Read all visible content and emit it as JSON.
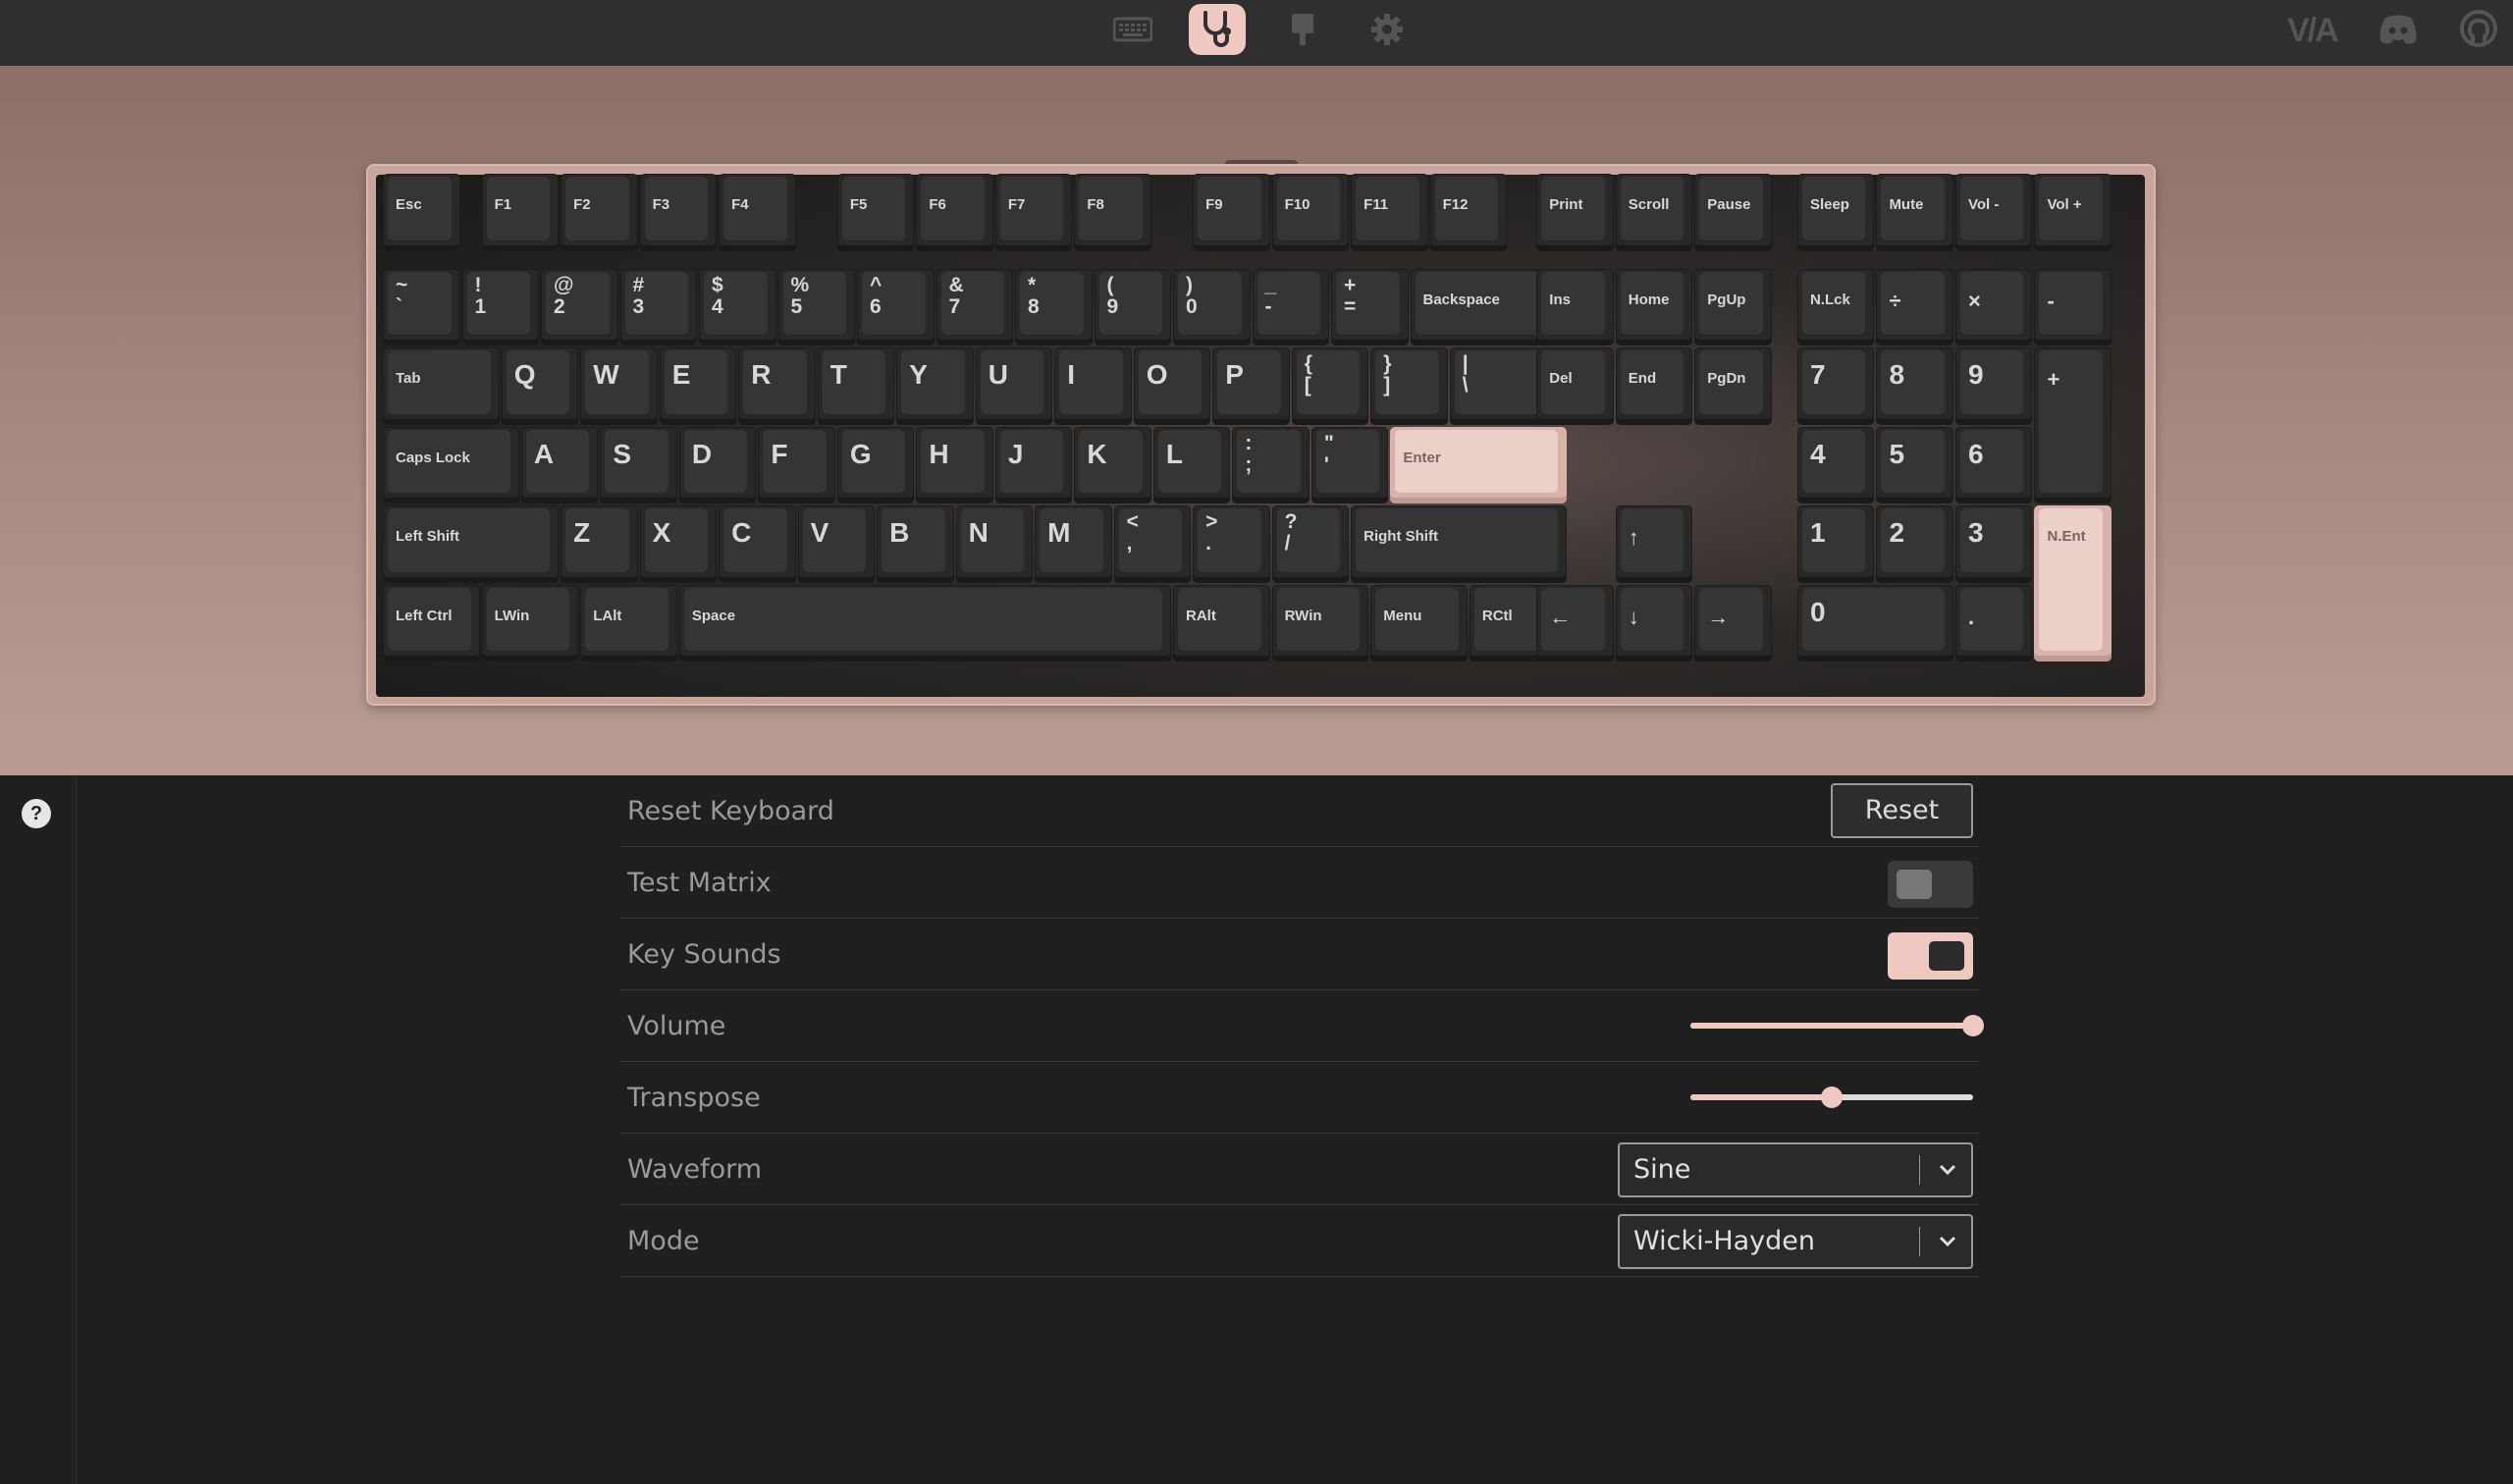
{
  "nav": {
    "items": [
      {
        "name": "keyboard-icon",
        "active": false
      },
      {
        "name": "stethoscope-icon",
        "active": true
      },
      {
        "name": "design-icon",
        "active": false
      },
      {
        "name": "gear-icon",
        "active": false
      }
    ],
    "brand_text": "V/A",
    "accent_color": "#efc8c1"
  },
  "keyboard": {
    "rows": {
      "function": [
        "Esc",
        "F1",
        "F2",
        "F3",
        "F4",
        "F5",
        "F6",
        "F7",
        "F8",
        "F9",
        "F10",
        "F11",
        "F12",
        "Print",
        "Scroll",
        "Pause",
        "Sleep",
        "Mute",
        "Vol -",
        "Vol +"
      ],
      "number": [
        "~\n`",
        "!\n1",
        "@\n2",
        "#\n3",
        "$\n4",
        "%\n5",
        "^\n6",
        "&\n7",
        "*\n8",
        "(\n9",
        ")\n0",
        "_\n-",
        "+\n=",
        "Backspace",
        "Ins",
        "Home",
        "PgUp",
        "N.Lck",
        "÷",
        "×",
        "-"
      ],
      "qwerty": [
        "Tab",
        "Q",
        "W",
        "E",
        "R",
        "T",
        "Y",
        "U",
        "I",
        "O",
        "P",
        "{\n[",
        "}\n]",
        "|\n\\",
        "Del",
        "End",
        "PgDn",
        "7",
        "8",
        "9",
        "+"
      ],
      "home": [
        "Caps Lock",
        "A",
        "S",
        "D",
        "F",
        "G",
        "H",
        "J",
        "K",
        "L",
        ":\n;",
        "\"\n'",
        "Enter",
        "4",
        "5",
        "6"
      ],
      "shift": [
        "Left Shift",
        "Z",
        "X",
        "C",
        "V",
        "B",
        "N",
        "M",
        "<\n,",
        ">\n.",
        "?\n/",
        "Right Shift",
        "↑",
        "1",
        "2",
        "3",
        "N.Ent"
      ],
      "bottom": [
        "Left Ctrl",
        "LWin",
        "LAlt",
        "Space",
        "RAlt",
        "RWin",
        "Menu",
        "RCtl",
        "←",
        "↓",
        "→",
        "0",
        "."
      ]
    }
  },
  "settings": {
    "reset_keyboard": {
      "label": "Reset Keyboard",
      "button": "Reset"
    },
    "test_matrix": {
      "label": "Test Matrix",
      "enabled": false
    },
    "key_sounds": {
      "label": "Key Sounds",
      "enabled": true
    },
    "volume": {
      "label": "Volume",
      "value": 1.0
    },
    "transpose": {
      "label": "Transpose",
      "value": 0.5
    },
    "waveform": {
      "label": "Waveform",
      "value": "Sine"
    },
    "mode": {
      "label": "Mode",
      "value": "Wicki-Hayden"
    }
  },
  "help_icon": "?"
}
